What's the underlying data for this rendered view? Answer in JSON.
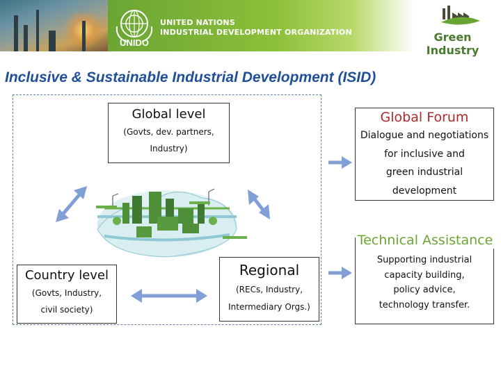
{
  "header": {
    "org_line1": "UNITED NATIONS",
    "org_line2": "INDUSTRIAL DEVELOPMENT ORGANIZATION",
    "logo_word": "UNIDO",
    "brand": "Green Industry",
    "colors": {
      "banner_green": "#6aa533",
      "brand_text": "#4a7a2e"
    }
  },
  "title": "Inclusive & Sustainable Industrial Development (ISID)",
  "levels": {
    "global": {
      "heading": "Global level",
      "line1": "(Govts, dev. partners,",
      "line2": "Industry)"
    },
    "country": {
      "heading": "Country level",
      "line1": "(Govts, Industry,",
      "line2": "civil society)"
    },
    "regional": {
      "heading": "Regional",
      "line1": "(RECs, Industry,",
      "line2": "Intermediary Orgs.)"
    }
  },
  "global_forum": {
    "heading": "Global Forum",
    "lines": [
      "Dialogue and negotiations",
      "for inclusive and",
      "green industrial",
      "development"
    ],
    "color": "#b0282c"
  },
  "technical_assistance": {
    "heading": "Technical Assistance",
    "lines": [
      "Supporting industrial",
      "capacity building,",
      "policy advice,",
      "technology transfer."
    ],
    "color": "#6aa533"
  },
  "arrow_color": "#7f9fd6",
  "icons": [
    "unido-logo-icon",
    "green-industry-logo-icon",
    "industrial-landscape-illustration"
  ]
}
